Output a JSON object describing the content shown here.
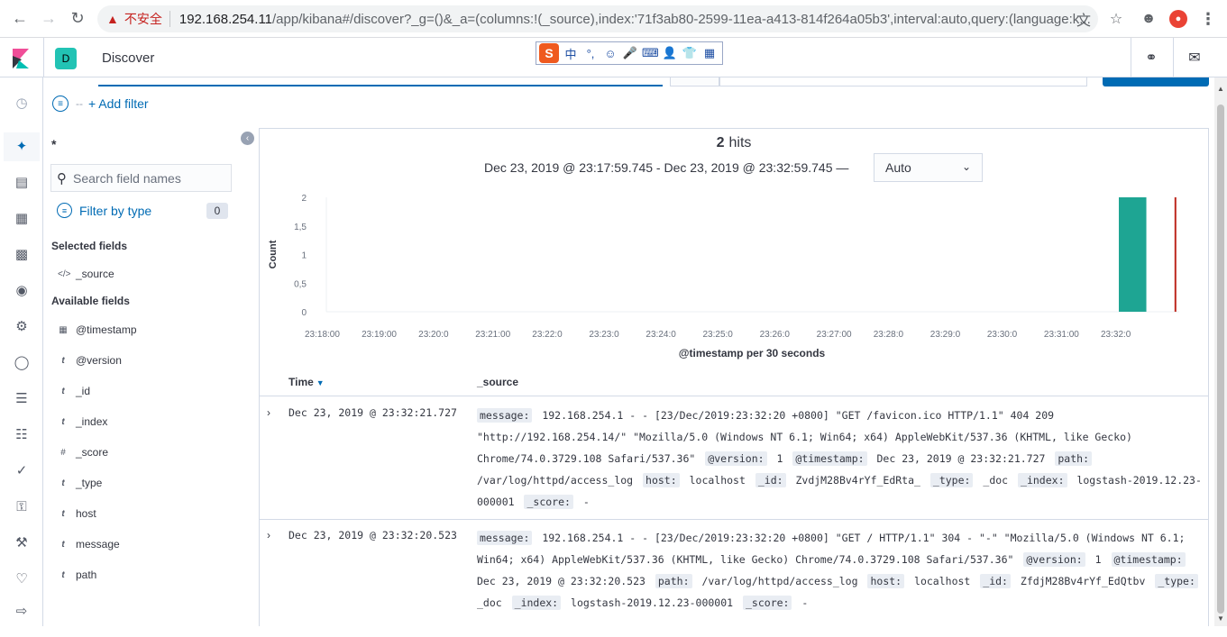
{
  "browser": {
    "insecure_label": "不安全",
    "url_host": "192.168.254.11",
    "url_path": "/app/kibana#/discover?_g=()&_a=(columns:!(_source),index:'71f3ab80-2599-11ea-a413-814f264a05b3',interval:auto,query:(language:k..."
  },
  "header": {
    "space_initial": "D",
    "breadcrumb": "Discover"
  },
  "ime": {
    "logo": "S",
    "items": [
      "中",
      "°,",
      "☺",
      "🎤",
      "⌨",
      "👤",
      "👕",
      "▦"
    ]
  },
  "filter_bar": {
    "separator": "--",
    "add_filter_label": "+ Add filter"
  },
  "sidebar": {
    "index_pattern": "*",
    "search_placeholder": "Search field names",
    "filter_by_type_label": "Filter by type",
    "filter_count": "0",
    "selected_fields_title": "Selected fields",
    "selected_fields": [
      {
        "type_icon": "</>",
        "name": "_source"
      }
    ],
    "available_fields_title": "Available fields",
    "available_fields": [
      {
        "type_icon": "calendar",
        "name": "@timestamp"
      },
      {
        "type_icon": "t",
        "name": "@version"
      },
      {
        "type_icon": "t",
        "name": "_id"
      },
      {
        "type_icon": "t",
        "name": "_index"
      },
      {
        "type_icon": "#",
        "name": "_score"
      },
      {
        "type_icon": "t",
        "name": "_type"
      },
      {
        "type_icon": "t",
        "name": "host"
      },
      {
        "type_icon": "t",
        "name": "message"
      },
      {
        "type_icon": "t",
        "name": "path"
      }
    ]
  },
  "main": {
    "hits_count": "2",
    "hits_label": "hits",
    "time_range": "Dec 23, 2019 @ 23:17:59.745 - Dec 23, 2019 @ 23:32:59.745 —",
    "interval_value": "Auto",
    "table_headers": {
      "time": "Time",
      "source": "_source"
    }
  },
  "chart_data": {
    "type": "bar",
    "ylabel": "Count",
    "xlabel": "@timestamp per 30 seconds",
    "ylim": [
      0,
      2
    ],
    "y_ticks": [
      "2",
      "1,5",
      "1",
      "0,5",
      "0"
    ],
    "x_ticks": [
      "23:18:00",
      "23:19:00",
      "23:20:0",
      "23:21:00",
      "23:22:0",
      "23:23:0",
      "23:24:0",
      "23:25:0",
      "23:26:0",
      "23:27:00",
      "23:28:0",
      "23:29:0",
      "23:30:0",
      "23:31:00",
      "23:32:0"
    ],
    "bars": [
      {
        "x": "23:32:00",
        "value": 2
      }
    ],
    "bar_color": "#1ea593",
    "now_marker_color": "#bd271e",
    "now_marker": "23:32:59.745"
  },
  "documents": [
    {
      "time": "Dec 23, 2019 @ 23:32:21.727",
      "fields": [
        {
          "key": "message:",
          "value": "192.168.254.1 - - [23/Dec/2019:23:32:20 +0800] \"GET /favicon.ico HTTP/1.1\" 404 209 \"http://192.168.254.14/\" \"Mozilla/5.0 (Windows NT 6.1; Win64; x64) AppleWebKit/537.36 (KHTML, like Gecko) Chrome/74.0.3729.108 Safari/537.36\""
        },
        {
          "key": "@version:",
          "value": "1"
        },
        {
          "key": "@timestamp:",
          "value": "Dec 23, 2019 @ 23:32:21.727"
        },
        {
          "key": "path:",
          "value": "/var/log/httpd/access_log"
        },
        {
          "key": "host:",
          "value": "localhost"
        },
        {
          "key": "_id:",
          "value": "ZvdjM28Bv4rYf_EdRta_"
        },
        {
          "key": "_type:",
          "value": "_doc"
        },
        {
          "key": "_index:",
          "value": "logstash-2019.12.23-000001"
        },
        {
          "key": "_score:",
          "value": "-"
        }
      ]
    },
    {
      "time": "Dec 23, 2019 @ 23:32:20.523",
      "fields": [
        {
          "key": "message:",
          "value": "192.168.254.1 - - [23/Dec/2019:23:32:20 +0800] \"GET / HTTP/1.1\" 304 - \"-\" \"Mozilla/5.0 (Windows NT 6.1; Win64; x64) AppleWebKit/537.36 (KHTML, like Gecko) Chrome/74.0.3729.108 Safari/537.36\""
        },
        {
          "key": "@version:",
          "value": "1"
        },
        {
          "key": "@timestamp:",
          "value": "Dec 23, 2019 @ 23:32:20.523"
        },
        {
          "key": "path:",
          "value": "/var/log/httpd/access_log"
        },
        {
          "key": "host:",
          "value": "localhost"
        },
        {
          "key": "_id:",
          "value": "ZfdjM28Bv4rYf_EdQtbv"
        },
        {
          "key": "_type:",
          "value": "_doc"
        },
        {
          "key": "_index:",
          "value": "logstash-2019.12.23-000001"
        },
        {
          "key": "_score:",
          "value": "-"
        }
      ]
    }
  ]
}
